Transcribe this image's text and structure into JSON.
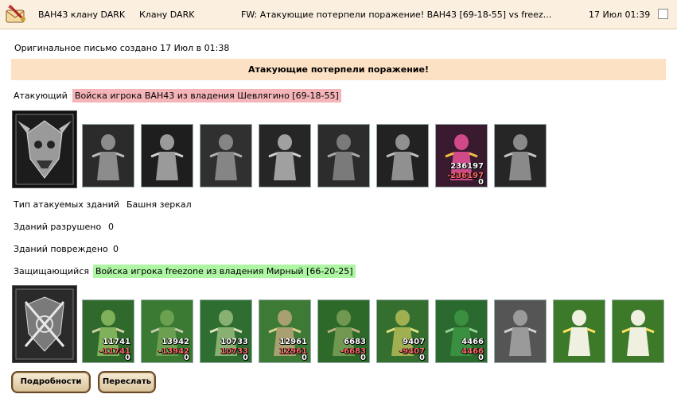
{
  "header": {
    "from": "ВАН43 клану DARK",
    "to": "Клану DARK",
    "subject": "FW: Атакующие потерпели поражение! ВАН43 [69-18-55] vs freez...",
    "date": "17 Июл 01:39",
    "icon": "sword-mail-icon"
  },
  "original_note": "Оригинальное письмо создано 17 Июл в 01:38",
  "banner": "Атакующие потерпели поражение!",
  "attacker": {
    "label": "Атакующий",
    "name": "Войска игрока ВАН43 из владения Шевлягино [69-18-55]",
    "emblem": "demon-skull-emblem",
    "units": [
      {
        "icon": "bone-dragon-unit",
        "n1": "",
        "n2": "",
        "n3": ""
      },
      {
        "icon": "skeleton-knight-unit",
        "n1": "",
        "n2": "",
        "n3": ""
      },
      {
        "icon": "werewolf-unit",
        "n1": "",
        "n2": "",
        "n3": ""
      },
      {
        "icon": "gargoyle-unit",
        "n1": "",
        "n2": "",
        "n3": ""
      },
      {
        "icon": "beast-unit",
        "n1": "",
        "n2": "",
        "n3": ""
      },
      {
        "icon": "dark-monk-unit",
        "n1": "",
        "n2": "",
        "n3": ""
      },
      {
        "icon": "succubus-unit",
        "n1": "236197",
        "n2": "-236197",
        "n3": "0"
      },
      {
        "icon": "reaper-unit",
        "n1": "",
        "n2": "",
        "n3": ""
      }
    ]
  },
  "buildings": {
    "type_label": "Тип атакуемых зданий",
    "type_value": "Башня зеркал",
    "destroyed_label": "Зданий разрушено",
    "destroyed_value": "0",
    "damaged_label": "Зданий повреждено",
    "damaged_value": "0"
  },
  "defender": {
    "label": "Защищающийся",
    "name": "Войска игрока freezone из владения Мирный [66-20-25]",
    "emblem": "crossed-bow-emblem",
    "units": [
      {
        "icon": "dwarf-unit",
        "n1": "11741",
        "n2": "-11741",
        "n3": "0"
      },
      {
        "icon": "pikeman-unit",
        "n1": "13942",
        "n2": "-13942",
        "n3": "0"
      },
      {
        "icon": "knight-unit",
        "n1": "10733",
        "n2": "10733",
        "n3": "0"
      },
      {
        "icon": "griffin-unit",
        "n1": "12961",
        "n2": "12961",
        "n3": "0"
      },
      {
        "icon": "archer-unit",
        "n1": "6683",
        "n2": "-6683",
        "n3": "0"
      },
      {
        "icon": "elf-dancer-unit",
        "n1": "9407",
        "n2": "-9407",
        "n3": "0"
      },
      {
        "icon": "druid-unit",
        "n1": "4466",
        "n2": "4466",
        "n3": "0"
      },
      {
        "icon": "stone-golem-unit",
        "n1": "",
        "n2": "",
        "n3": ""
      },
      {
        "icon": "glowing-pawn-unit",
        "n1": "",
        "n2": "",
        "n3": ""
      },
      {
        "icon": "glowing-pawn-unit",
        "n1": "",
        "n2": "",
        "n3": ""
      }
    ]
  },
  "buttons": {
    "details": "Подробности",
    "forward": "Переслать"
  },
  "colors": {
    "header_bg": "#fbefe0",
    "banner_bg": "#fde1c4",
    "attacker_hl": "#f4b4b8",
    "defender_hl": "#aef5a4"
  }
}
